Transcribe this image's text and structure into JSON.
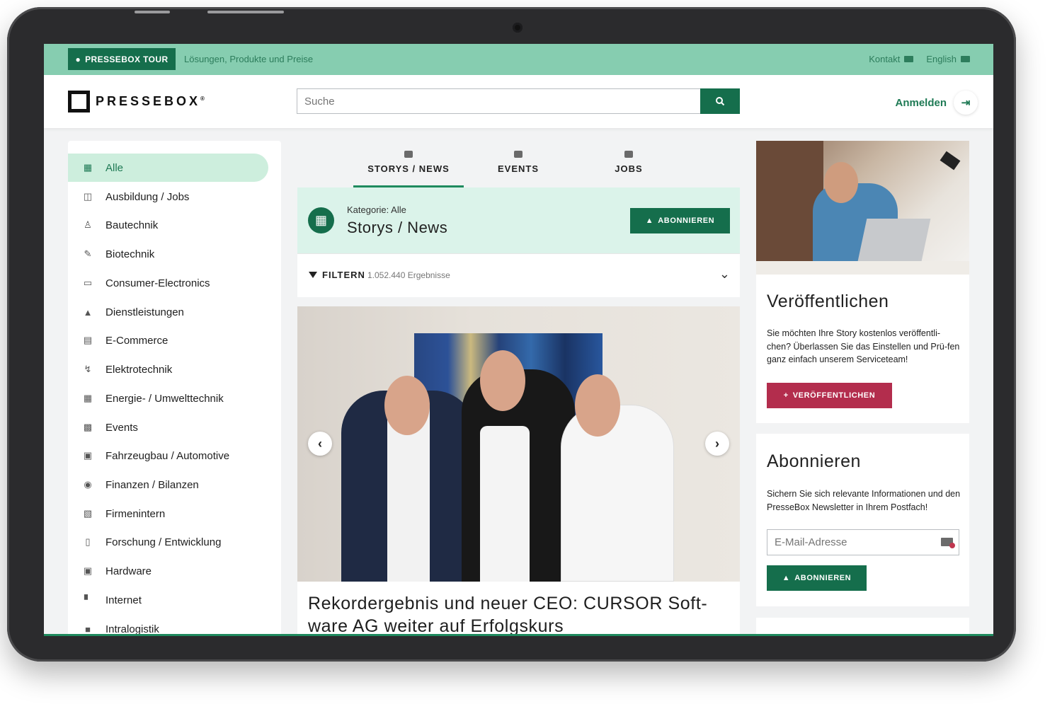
{
  "topbar": {
    "tour_label": "PRESSEBOX TOUR",
    "tour_sub": "Lösungen, Produkte und Preise",
    "contact": "Kontakt",
    "language": "English"
  },
  "header": {
    "logo": "PRESSEBOX",
    "logo_mark": "®",
    "search_placeholder": "Suche",
    "login": "Anmelden"
  },
  "sidebar": {
    "items": [
      {
        "label": "Alle",
        "icon": "grid-icon"
      },
      {
        "label": "Ausbildung / Jobs",
        "icon": "whiteboard-icon"
      },
      {
        "label": "Bautechnik",
        "icon": "worker-icon"
      },
      {
        "label": "Biotechnik",
        "icon": "syringe-icon"
      },
      {
        "label": "Consumer-Electronics",
        "icon": "devices-icon"
      },
      {
        "label": "Dienstleistungen",
        "icon": "bell-service-icon"
      },
      {
        "label": "E-Commerce",
        "icon": "cash-register-icon"
      },
      {
        "label": "Elektrotechnik",
        "icon": "bolt-icon"
      },
      {
        "label": "Energie- / Umwelttechnik",
        "icon": "solar-panel-icon"
      },
      {
        "label": "Events",
        "icon": "calendar-icon"
      },
      {
        "label": "Fahrzeugbau / Automotive",
        "icon": "car-icon"
      },
      {
        "label": "Finanzen / Bilanzen",
        "icon": "piggy-bank-icon"
      },
      {
        "label": "Firmenintern",
        "icon": "building-icon"
      },
      {
        "label": "Forschung / Entwicklung",
        "icon": "flask-icon"
      },
      {
        "label": "Hardware",
        "icon": "chip-icon"
      },
      {
        "label": "Internet",
        "icon": "router-icon"
      },
      {
        "label": "Intralogistik",
        "icon": "forklift-icon"
      }
    ]
  },
  "tabs": [
    {
      "label": "STORYS / NEWS",
      "icon": "news-icon",
      "active": true
    },
    {
      "label": "EVENTS",
      "icon": "calendar-icon",
      "active": false
    },
    {
      "label": "JOBS",
      "icon": "briefcase-icon",
      "active": false
    }
  ],
  "category": {
    "kicker": "Kategorie: Alle",
    "title": "Storys / News",
    "subscribe": "ABONNIEREN"
  },
  "filter": {
    "label": "FILTERN",
    "count": "1.052.440 Ergebnisse"
  },
  "article": {
    "headline": "Rekordergebnis und neuer CEO: CURSOR Soft-ware AG weiter auf Erfolgskurs"
  },
  "publish": {
    "title": "Veröffentlichen",
    "text": "Sie möchten Ihre Story kostenlos veröffentli-chen? Überlassen Sie das Einstellen und Prü-fen ganz einfach unserem Serviceteam!",
    "button": "VERÖFFENTLICHEN"
  },
  "subscribe": {
    "title": "Abonnieren",
    "text": "Sichern Sie sich relevante Informationen und den PresseBox Newsletter in Ihrem Postfach!",
    "email_placeholder": "E-Mail-Adresse",
    "button": "ABONNIEREN"
  },
  "colors": {
    "brand_green": "#156e4c",
    "topbar_green": "#86cdb0",
    "active_bg": "#cdeedd",
    "publish_red": "#b32d4d"
  }
}
